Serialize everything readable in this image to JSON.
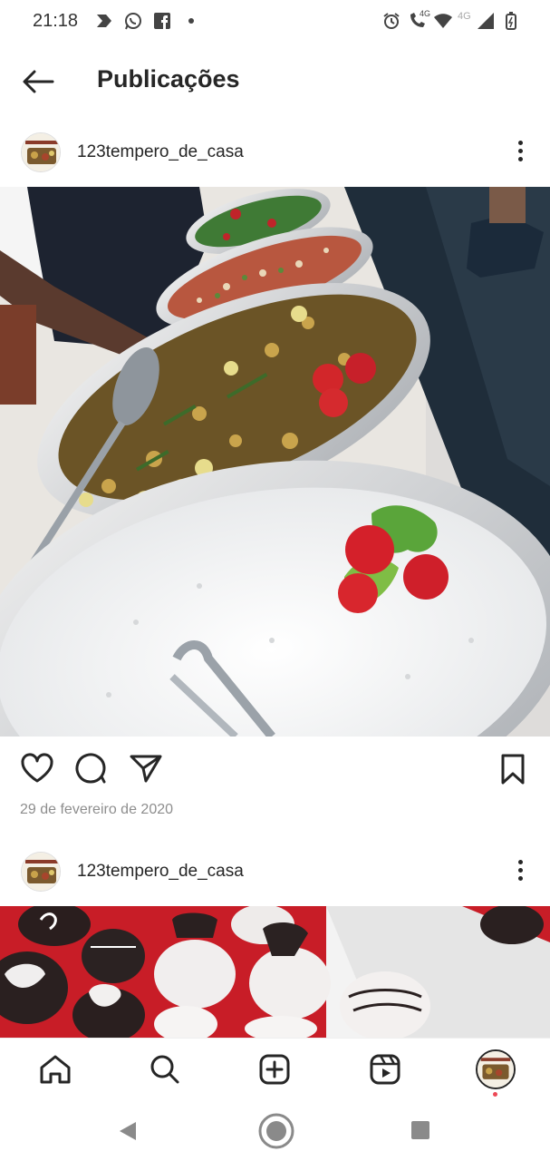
{
  "status_bar": {
    "time": "21:18",
    "signal_label_1": "4G",
    "signal_label_2": "4G"
  },
  "header": {
    "title": "Publicações"
  },
  "posts": [
    {
      "username": "123tempero_de_casa",
      "date": "29 de fevereiro de 2020"
    },
    {
      "username": "123tempero_de_casa"
    }
  ],
  "colors": {
    "accent_dot": "#ed4956",
    "text": "#262626",
    "muted": "#8e8e8e"
  },
  "icons": {
    "status": [
      "cast-icon",
      "whatsapp-icon",
      "facebook-icon",
      "dot-icon",
      "alarm-icon",
      "call-icon",
      "wifi-icon",
      "signal-icon",
      "battery-icon"
    ],
    "post_actions": [
      "heart-icon",
      "comment-icon",
      "share-icon",
      "bookmark-icon"
    ],
    "bottom_nav": [
      "home-icon",
      "search-icon",
      "new-post-icon",
      "reels-icon",
      "profile-avatar"
    ],
    "system_nav": [
      "back-icon",
      "home-circle-icon",
      "recents-icon"
    ]
  }
}
